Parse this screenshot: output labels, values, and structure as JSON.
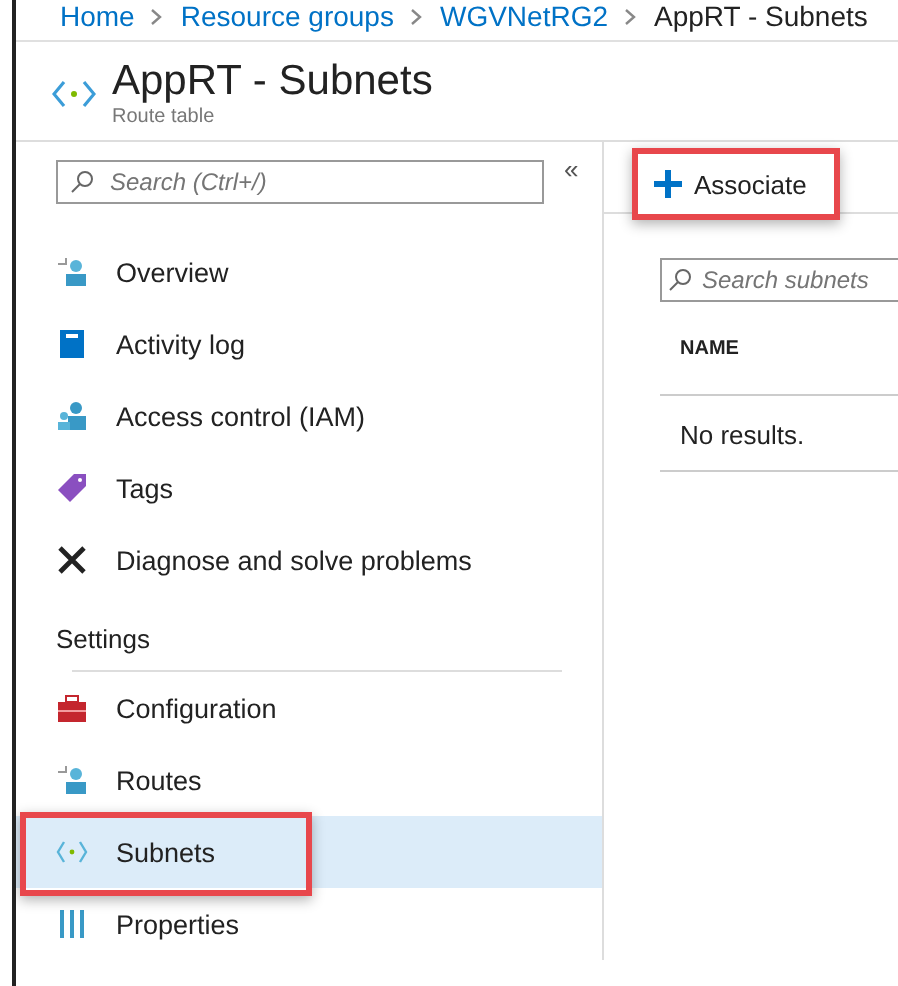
{
  "breadcrumb": [
    "Home",
    "Resource groups",
    "WGVNetRG2",
    "AppRT - Subnets"
  ],
  "header": {
    "title": "AppRT - Subnets",
    "subtitle": "Route table"
  },
  "sidebar": {
    "search": {
      "placeholder": "Search (Ctrl+/)"
    },
    "collapse": "«",
    "items": [
      {
        "label": "Overview",
        "selected": false,
        "highlighted": false
      },
      {
        "label": "Activity log",
        "selected": false,
        "highlighted": false
      },
      {
        "label": "Access control (IAM)",
        "selected": false,
        "highlighted": false
      },
      {
        "label": "Tags",
        "selected": false,
        "highlighted": false
      },
      {
        "label": "Diagnose and solve problems",
        "selected": false,
        "highlighted": false
      }
    ],
    "section": "Settings",
    "settings_items": [
      {
        "label": "Configuration",
        "selected": false,
        "highlighted": false
      },
      {
        "label": "Routes",
        "selected": false,
        "highlighted": false
      },
      {
        "label": "Subnets",
        "selected": true,
        "highlighted": true
      },
      {
        "label": "Properties",
        "selected": false,
        "highlighted": false
      }
    ]
  },
  "toolbar": {
    "button": {
      "label": "Associate",
      "highlighted": true
    }
  },
  "content": {
    "search": {
      "placeholder": "Search subnets"
    },
    "table": {
      "columns": [
        "NAME"
      ],
      "empty": "No results."
    }
  }
}
